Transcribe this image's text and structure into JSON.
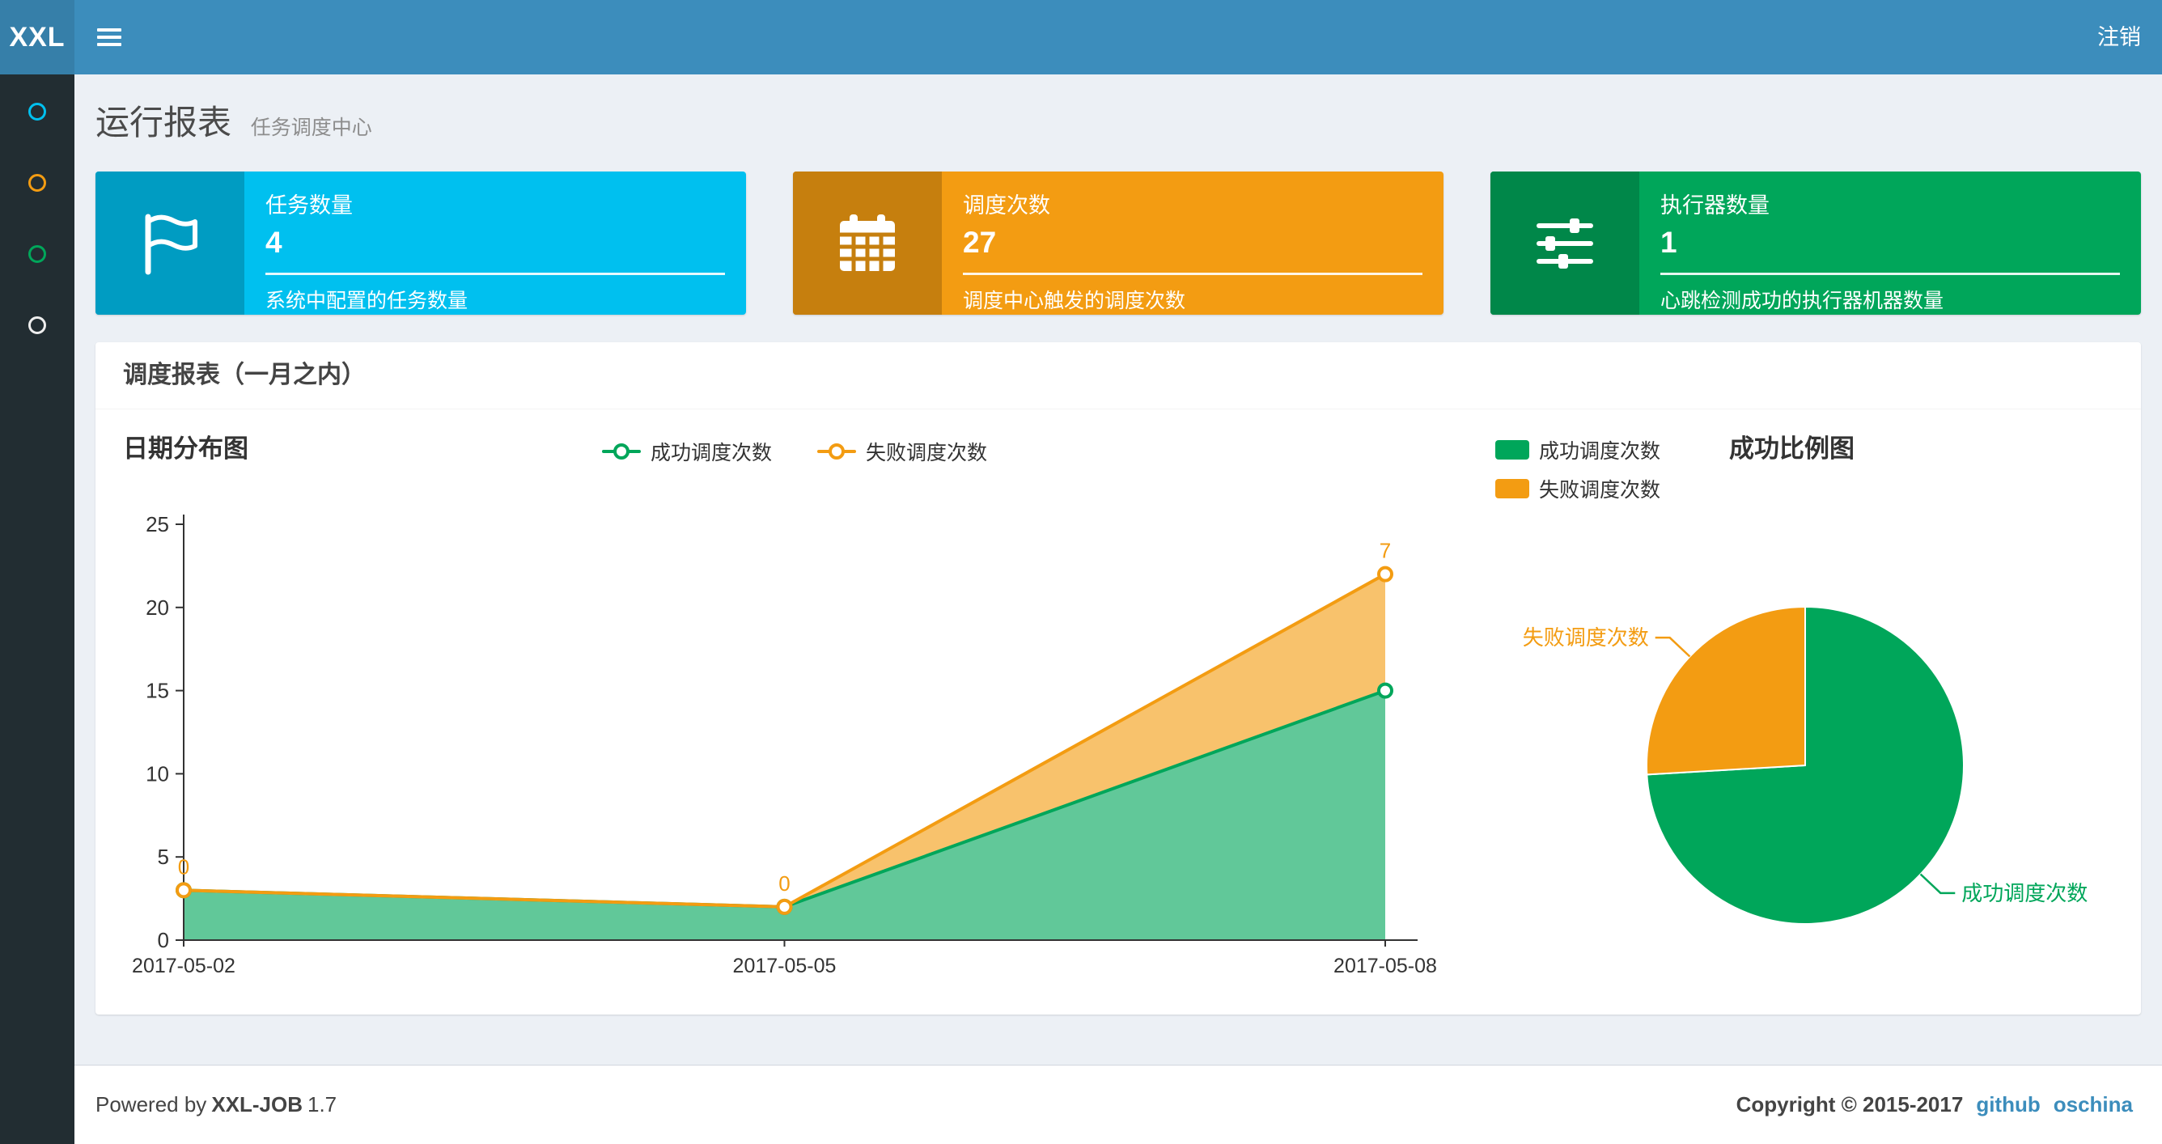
{
  "navbar": {
    "logo": "XXL",
    "logout": "注销"
  },
  "sidebar": {
    "items": [
      {
        "icon": "circle-icon",
        "color": "#00c0ef"
      },
      {
        "icon": "circle-icon",
        "color": "#f39c12"
      },
      {
        "icon": "circle-icon",
        "color": "#00a65a"
      },
      {
        "icon": "circle-icon",
        "color": "#eeeeee"
      }
    ]
  },
  "page": {
    "title": "运行报表",
    "subtitle": "任务调度中心"
  },
  "info_boxes": [
    {
      "label": "任务数量",
      "value": "4",
      "desc": "系统中配置的任务数量",
      "color": "#00c0ef",
      "icon": "flag-icon"
    },
    {
      "label": "调度次数",
      "value": "27",
      "desc": "调度中心触发的调度次数",
      "color": "#f39c12",
      "icon": "calendar-icon"
    },
    {
      "label": "执行器数量",
      "value": "1",
      "desc": "心跳检测成功的执行器机器数量",
      "color": "#00a65a",
      "icon": "sliders-icon"
    }
  ],
  "panel": {
    "title": "调度报表（一月之内）"
  },
  "chart_data": [
    {
      "type": "area",
      "title": "日期分布图",
      "categories": [
        "2017-05-02",
        "2017-05-05",
        "2017-05-08"
      ],
      "series": [
        {
          "name": "成功调度次数",
          "color": "#00a65a",
          "values": [
            3,
            2,
            15
          ],
          "stacked": true
        },
        {
          "name": "失败调度次数",
          "color": "#f39c12",
          "values": [
            0,
            0,
            7
          ],
          "stacked": true,
          "point_labels": [
            "0",
            "0",
            "7"
          ]
        }
      ],
      "ylim": [
        0,
        25
      ],
      "yticks": [
        0,
        5,
        10,
        15,
        20,
        25
      ],
      "legend_position": "top-center",
      "grid": false
    },
    {
      "type": "pie",
      "title": "成功比例图",
      "slices": [
        {
          "name": "成功调度次数",
          "value": 20,
          "color": "#00a65a"
        },
        {
          "name": "失败调度次数",
          "value": 7,
          "color": "#f39c12"
        }
      ],
      "legend_position": "top-left"
    }
  ],
  "footer": {
    "powered_by": "Powered by",
    "app_name": "XXL-JOB",
    "version": "1.7",
    "copyright": "Copyright © 2015-2017",
    "links": [
      "github",
      "oschina"
    ]
  },
  "colors": {
    "navbar": "#3c8dbc",
    "navbar_logo_bg": "#367fa9",
    "sidebar_bg": "#222d32",
    "content_bg": "#ecf0f5",
    "link": "#3c8dbc"
  }
}
